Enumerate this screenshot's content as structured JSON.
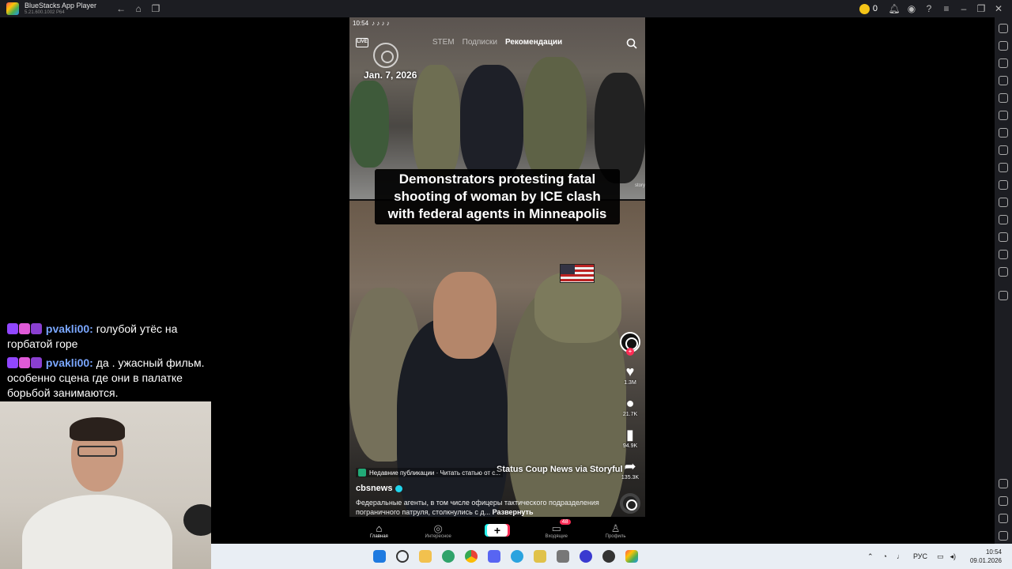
{
  "titlebar": {
    "app_name": "BlueStacks App Player",
    "version": "5.21.600.1002 P64",
    "coin_count": "0"
  },
  "phone": {
    "status_time": "10:54",
    "live_label": "LIVE",
    "tabs": [
      "STEM",
      "Подписки",
      "Рекомендации"
    ],
    "active_tab": "Рекомендации",
    "date_tag": "Jan. 7, 2026",
    "storyful_small": "story",
    "headline": "Demonstrators protesting fatal shooting of woman by ICE clash with federal agents in Minneapolis",
    "actions": {
      "likes": "1.3M",
      "comments": "21.7K",
      "saves": "94.9K",
      "shares": "135.3K"
    },
    "credit": "Status Coup News via Storyful",
    "recent_label": "Недавние публикации · Читать статью от с...",
    "author": "cbsnews",
    "caption": "Федеральные агенты, в том числе офицеры тактического подразделения пограничного патруля, столкнулись с д...",
    "caption_more": "Развернуть",
    "nav": {
      "home": "Главная",
      "discover": "Интересное",
      "inbox": "Входящие",
      "inbox_badge": "48",
      "profile": "Профиль"
    }
  },
  "chat": [
    {
      "user": "pvakli00:",
      "text": "голубой утёс на горбатой горе"
    },
    {
      "user": "pvakli00:",
      "text": "да . ужасный фильм. особенно сцена где они в палатке борьбой занимаются."
    }
  ],
  "taskbar": {
    "lang": "РУС",
    "time": "10:54",
    "date": "09.01.2026"
  },
  "colors": {
    "tiktok_red": "#fe2c55",
    "tiktok_cyan": "#25f4ee",
    "chat_username": "#7aa7ff",
    "bluestacks_bar": "#1c1d22"
  }
}
